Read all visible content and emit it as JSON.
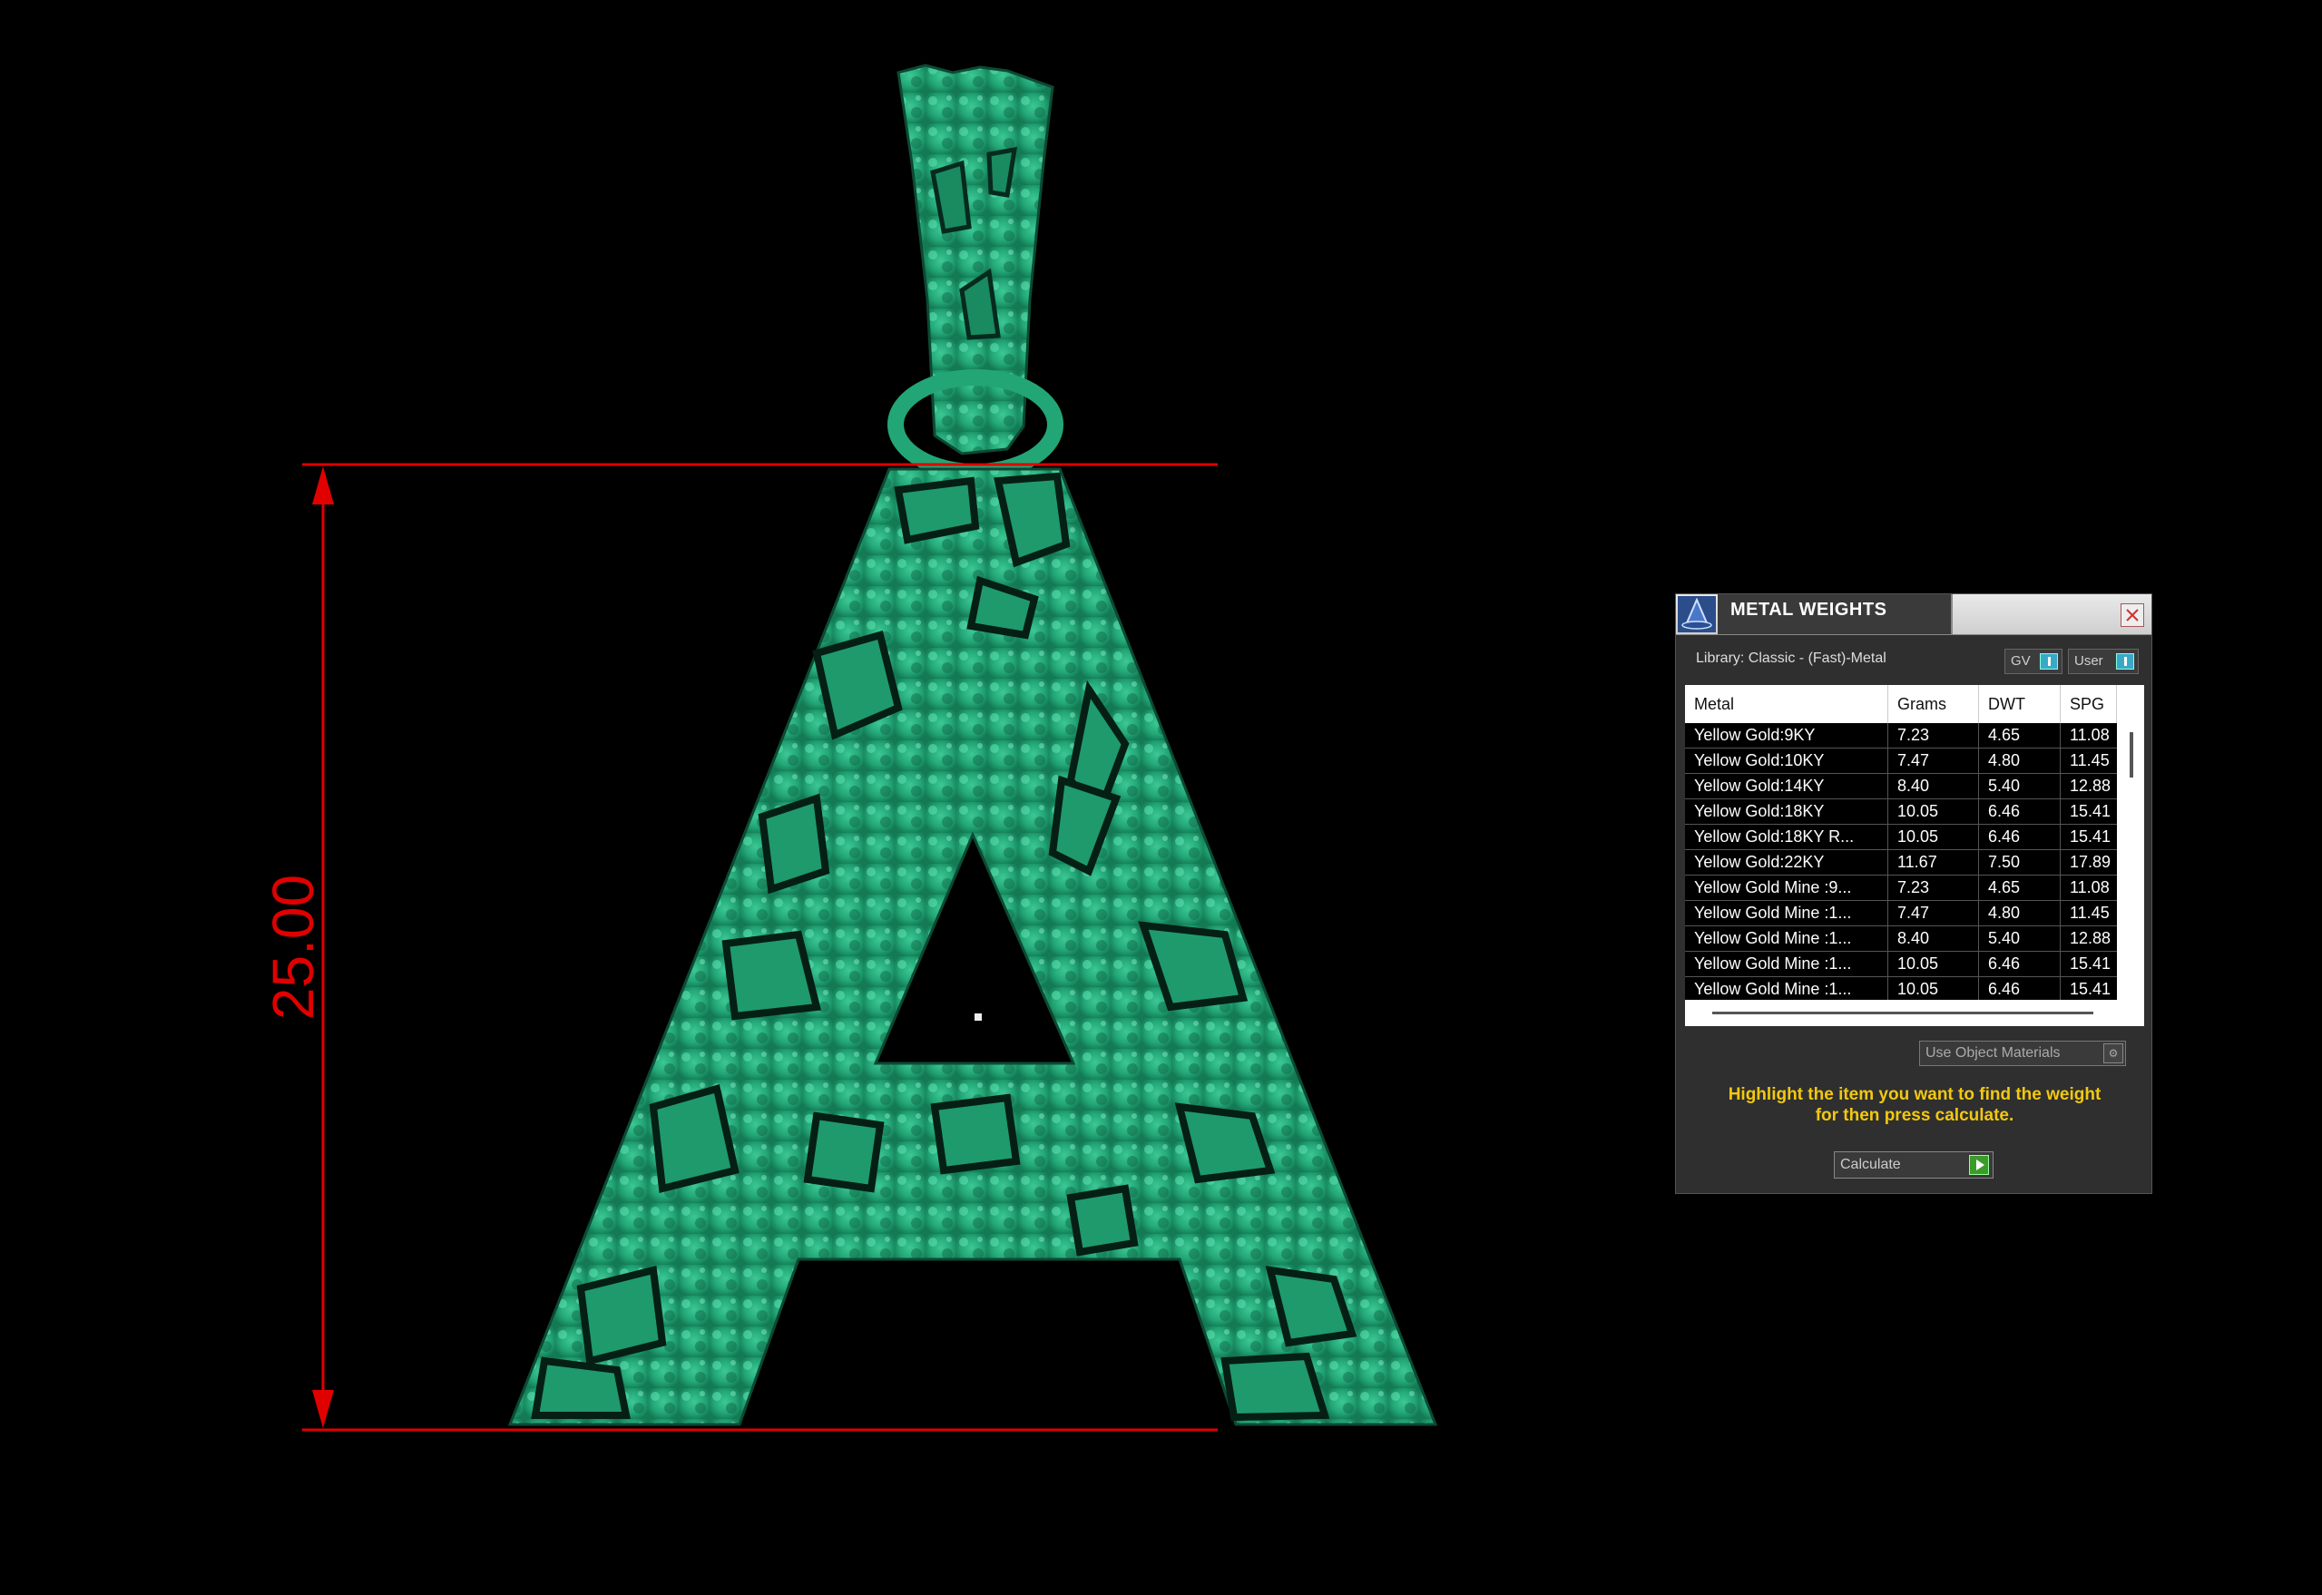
{
  "viewport": {
    "dimension_value": "25.00",
    "colors": {
      "model": "#2aa87a",
      "dimension": "#e00000",
      "background": "#000000"
    }
  },
  "panel": {
    "title": "METAL WEIGHTS",
    "logo_icon": "wizard-hat-icon",
    "close_icon": "close-icon",
    "library_label": "Library: Classic - (Fast)-Metal",
    "toggle_gv": "GV",
    "toggle_user": "User",
    "columns": [
      "Metal",
      "Grams",
      "DWT",
      "SPG"
    ],
    "rows": [
      {
        "metal": "Yellow Gold:9KY",
        "grams": "7.23",
        "dwt": "4.65",
        "spg": "11.08"
      },
      {
        "metal": "Yellow Gold:10KY",
        "grams": "7.47",
        "dwt": "4.80",
        "spg": "11.45"
      },
      {
        "metal": "Yellow Gold:14KY",
        "grams": "8.40",
        "dwt": "5.40",
        "spg": "12.88"
      },
      {
        "metal": "Yellow Gold:18KY",
        "grams": "10.05",
        "dwt": "6.46",
        "spg": "15.41"
      },
      {
        "metal": "Yellow Gold:18KY R...",
        "grams": "10.05",
        "dwt": "6.46",
        "spg": "15.41"
      },
      {
        "metal": "Yellow Gold:22KY",
        "grams": "11.67",
        "dwt": "7.50",
        "spg": "17.89"
      },
      {
        "metal": "Yellow Gold Mine :9...",
        "grams": "7.23",
        "dwt": "4.65",
        "spg": "11.08"
      },
      {
        "metal": "Yellow Gold Mine :1...",
        "grams": "7.47",
        "dwt": "4.80",
        "spg": "11.45"
      },
      {
        "metal": "Yellow Gold Mine :1...",
        "grams": "8.40",
        "dwt": "5.40",
        "spg": "12.88"
      },
      {
        "metal": "Yellow Gold Mine :1...",
        "grams": "10.05",
        "dwt": "6.46",
        "spg": "15.41"
      },
      {
        "metal": "Yellow Gold Mine :1...",
        "grams": "10.05",
        "dwt": "6.46",
        "spg": "15.41"
      }
    ],
    "use_object_materials": "Use Object Materials",
    "instruction_line1": "Highlight the item you want to find the weight",
    "instruction_line2": "for then press calculate.",
    "calculate_label": "Calculate",
    "colors": {
      "instruction": "#f2c811",
      "calc_play": "#3c9c2a",
      "toggle": "#3aa9c8"
    }
  }
}
